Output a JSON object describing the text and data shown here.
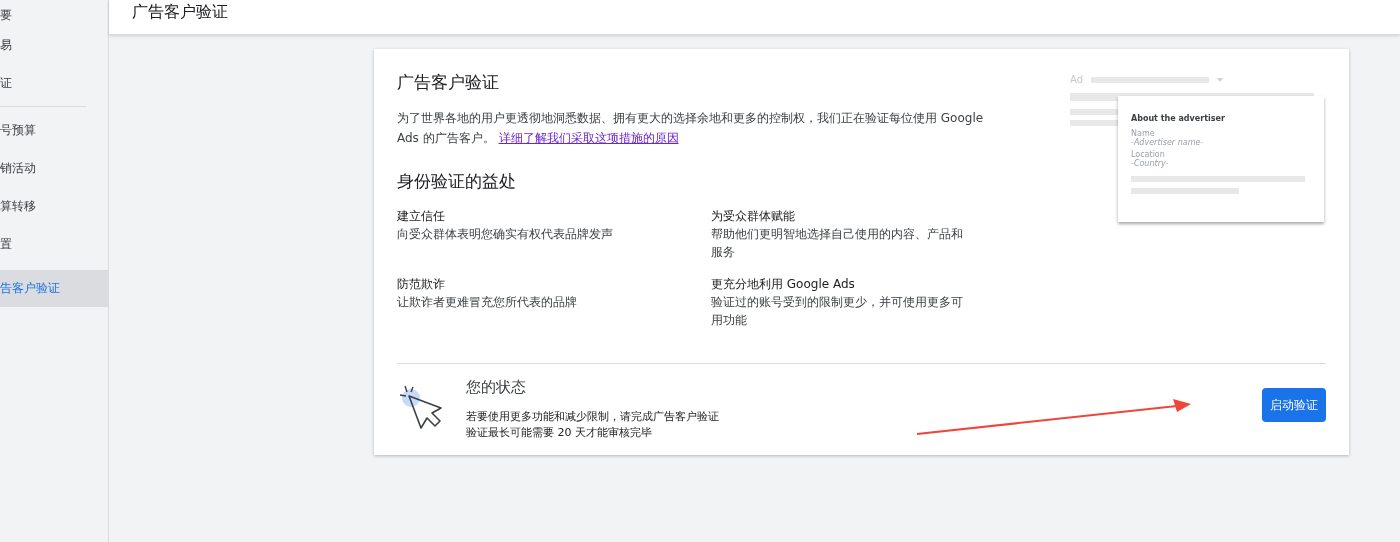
{
  "sidebar": {
    "items": [
      {
        "label": "要",
        "selected": false
      },
      {
        "label": "易",
        "selected": false
      },
      {
        "label": "证",
        "selected": false,
        "divider_after": true
      },
      {
        "label": "号预算",
        "selected": false
      },
      {
        "label": "销活动",
        "selected": false
      },
      {
        "label": "算转移",
        "selected": false
      },
      {
        "label": "置",
        "selected": false
      },
      {
        "label": "告客户验证",
        "selected": true
      }
    ]
  },
  "header": {
    "title": "广告客户验证"
  },
  "card": {
    "title": "广告客户验证",
    "intro": "为了世界各地的用户更透彻地洞悉数据、拥有更大的选择余地和更多的控制权，我们正在验证每位使用 Google Ads 的广告客户。",
    "link": "详细了解我们采取这项措施的原因",
    "illustration": {
      "ad_label": "Ad",
      "panel_title": "About the advertiser",
      "fields": [
        {
          "label": "Name",
          "value": "-Advertiser name-"
        },
        {
          "label": "Location",
          "value": "-Country-"
        }
      ]
    },
    "benefits_title": "身份验证的益处",
    "benefits": [
      {
        "title": "建立信任",
        "text": "向受众群体表明您确实有权代表品牌发声"
      },
      {
        "title": "为受众群体赋能",
        "text": "帮助他们更明智地选择自己使用的内容、产品和服务"
      },
      {
        "title": "防范欺诈",
        "text": "让欺诈者更难冒充您所代表的品牌"
      },
      {
        "title": "更充分地利用 Google Ads",
        "text": "验证过的账号受到的限制更少，并可使用更多可用功能"
      }
    ],
    "status": {
      "title": "您的状态",
      "lines": [
        "若要使用更多功能和减少限制，请完成广告客户验证",
        "验证最长可能需要 20 天才能审核完毕"
      ],
      "button": "启动验证"
    }
  }
}
